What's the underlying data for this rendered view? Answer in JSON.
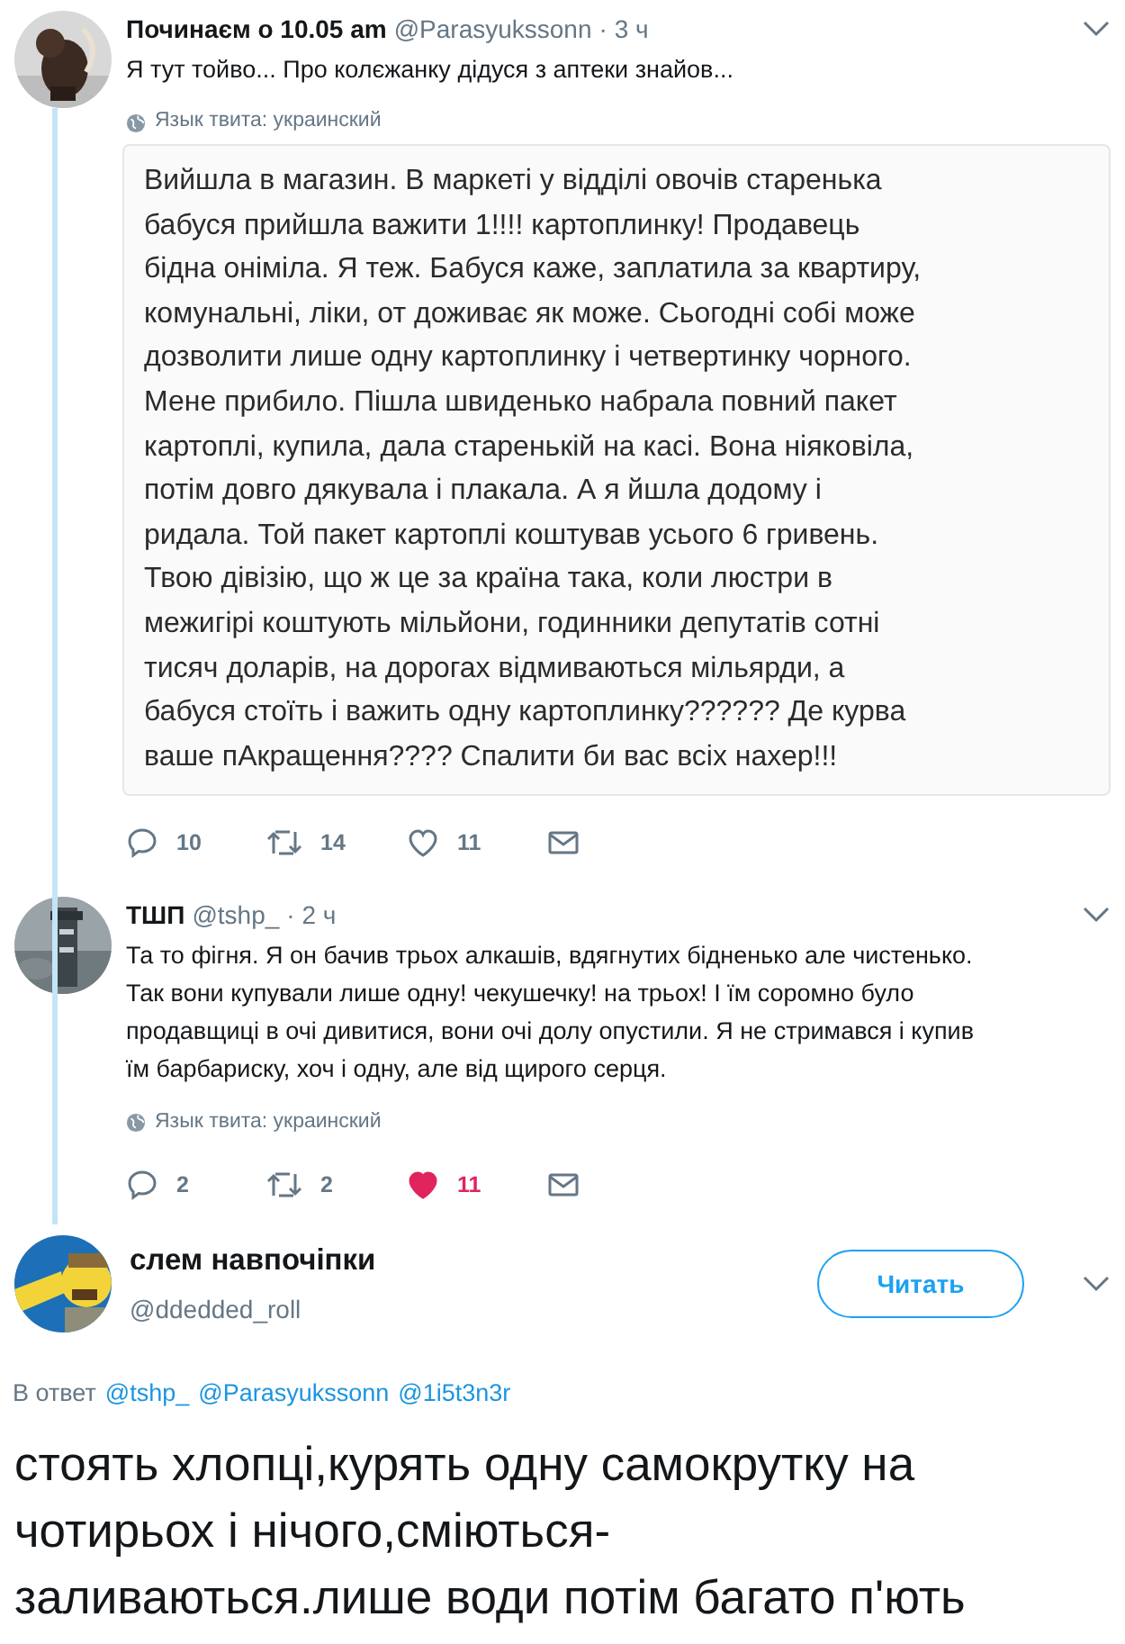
{
  "thread_tweets": [
    {
      "name": "Починаєм о 10.05 am",
      "handle": "@Parasyukssonn",
      "time": "· 3 ч",
      "text": "Я тут тойво... Про колєжанку дідуся з аптеки знайов...",
      "language": "Язык твита: украинский",
      "attachment_lines": [
        "Вийшла в магазин. В маркеті у відділі овочів старенька",
        "бабуся прийшла важити 1!!!! картоплинку! Продавець",
        "бідна оніміла. Я теж. Бабуся каже, заплатила за квартиру,",
        "комунальні, ліки, от доживає як може. Сьогодні собі може",
        "дозволити лише одну картоплинку і четвертинку чорного.",
        "Мене прибило. Пішла швиденько набрала повний пакет",
        "картоплі, купила, дала старенькій на касі. Вона ніяковіла,",
        "потім довго дякувала і плакала. А я йшла додому і",
        "ридала. Той пакет картоплі коштував усього 6 гривень.",
        "Твою дівізію, що ж це за країна така, коли люстри в",
        "межигірі коштують мільйони, годинники депутатів сотні",
        "тисяч доларів, на дорогах відмиваються мільярди, а",
        "бабуся стоїть і важить одну картоплинку?????? Де курва",
        "ваше пАкращення???? Спалити би вас всіх нахер!!!"
      ],
      "replies": "10",
      "retweets": "14",
      "likes": "11",
      "liked": false
    },
    {
      "name": "ТШП",
      "handle": "@tshp_",
      "time": "· 2 ч",
      "text_lines": [
        "Та то фігня. Я он бачив трьох алкашів, вдягнутих бідненько але чистенько.",
        "Так вони купували лише одну! чекушечку! на трьох! І їм соромно було",
        "продавщиці в очі дивитися, вони очі долу опустили. Я не стримався і купив",
        "їм барбариску, хоч і одну, але від щирого серця."
      ],
      "language": "Язык твита: украинский",
      "replies": "2",
      "retweets": "2",
      "likes": "11",
      "liked": true
    }
  ],
  "main_tweet": {
    "name": "слем навпочіпки",
    "handle": "@ddedded_roll",
    "follow_button": "Читать",
    "reply_label": "В ответ",
    "reply_to": [
      "@tshp_",
      "@Parasyukssonn",
      "@1i5t3n3r"
    ],
    "text_lines": [
      "стоять хлопці,курять одну самокрутку на",
      "чотирьох і нічого,сміються-",
      "заливаються.лише води потім багато п'ють"
    ]
  }
}
